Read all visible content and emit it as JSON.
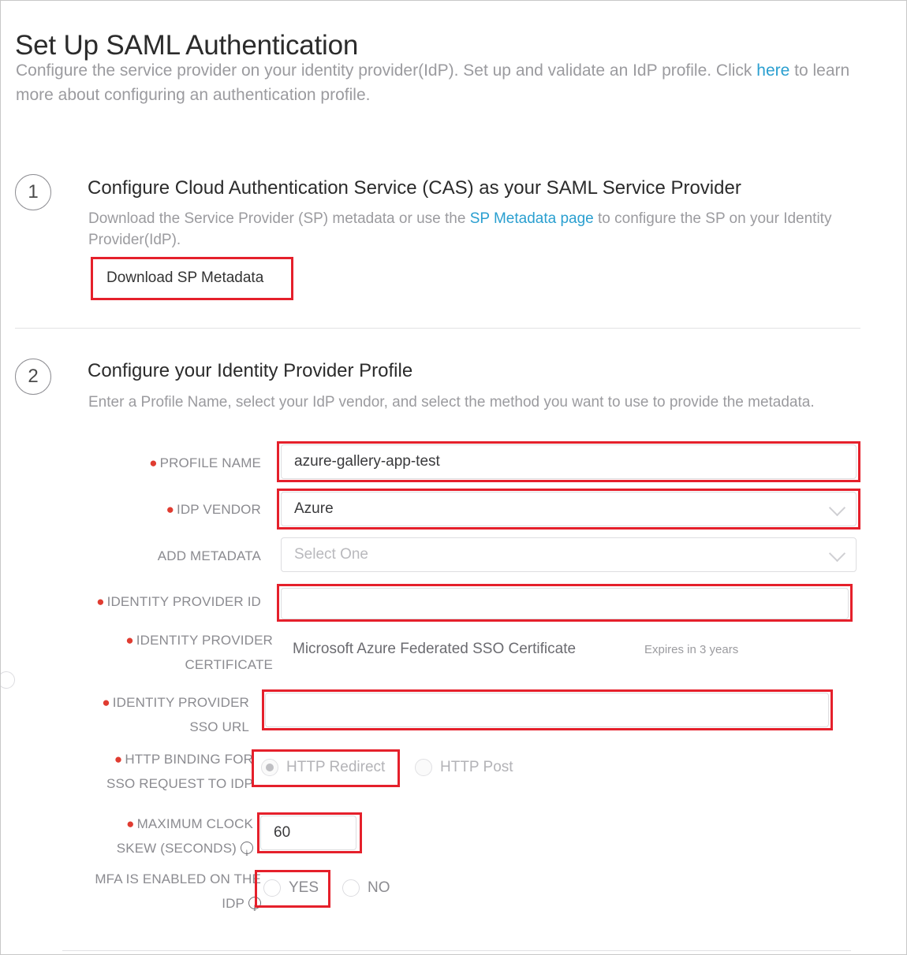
{
  "header": {
    "title": "Set Up SAML Authentication",
    "desc_part1": "Configure the service provider on your identity provider(IdP). Set up and validate an IdP profile. Click ",
    "desc_link": "here",
    "desc_part2": " to learn more about configuring an authentication profile."
  },
  "colors": {
    "annotation_red": "#e5202b",
    "link_blue": "#2a9fd0",
    "required_dot": "#e03c31",
    "muted_text": "#9b9b9f"
  },
  "steps": [
    {
      "number": "1",
      "title": "Configure Cloud Authentication Service (CAS) as your SAML Service Provider",
      "desc_part1": "Download the Service Provider (SP) metadata or use the ",
      "desc_link": "SP Metadata page",
      "desc_part2": " to configure the SP on your Identity Provider(IdP).",
      "button_label": "Download SP Metadata"
    },
    {
      "number": "2",
      "title": "Configure your Identity Provider Profile",
      "desc": "Enter a Profile Name, select your IdP vendor, and select the method you want to use to provide the metadata."
    }
  ],
  "form": {
    "profile_name": {
      "label": "PROFILE NAME",
      "required": true,
      "value": "azure-gallery-app-test",
      "placeholder": ""
    },
    "idp_vendor": {
      "label": "IDP VENDOR",
      "required": true,
      "value": "Azure",
      "icon": "chevron-down-icon"
    },
    "add_metadata": {
      "label": "ADD METADATA",
      "required": false,
      "value": "Select One",
      "is_placeholder": true,
      "icon": "chevron-down-icon"
    },
    "identity_provider_id": {
      "label": "IDENTITY PROVIDER ID",
      "required": true,
      "value": "",
      "placeholder": ""
    },
    "identity_provider_certificate": {
      "label_line1": "IDENTITY PROVIDER",
      "label_line2": "CERTIFICATE",
      "required": true,
      "value": "Microsoft Azure Federated SSO Certificate",
      "expiry_note": "Expires in 3 years"
    },
    "identity_provider_sso_url": {
      "label_line1": "IDENTITY PROVIDER",
      "label_line2": "SSO URL",
      "required": true,
      "value": "",
      "placeholder": ""
    },
    "http_binding": {
      "label_line1": "HTTP BINDING FOR",
      "label_line2": "SSO REQUEST TO IDP",
      "required": true,
      "options": [
        {
          "label": "HTTP Redirect",
          "checked": true
        },
        {
          "label": "HTTP Post",
          "checked": false
        }
      ]
    },
    "max_clock_skew": {
      "label_line1": "MAXIMUM CLOCK",
      "label_line2": "SKEW (SECONDS)",
      "required": true,
      "info_icon": "info-icon",
      "value": "60"
    },
    "mfa_enabled": {
      "label_line1": "MFA IS ENABLED ON THE",
      "label_line2": "IDP",
      "required": false,
      "info_icon": "info-icon",
      "options": [
        {
          "label": "YES",
          "checked": false
        },
        {
          "label": "NO",
          "checked": false
        }
      ]
    }
  }
}
